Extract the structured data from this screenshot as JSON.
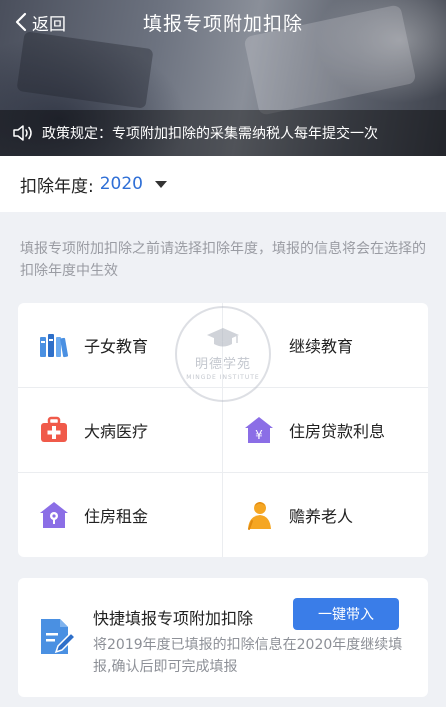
{
  "header": {
    "back_label": "返回",
    "title": "填报专项附加扣除"
  },
  "notice": {
    "text": "政策规定：专项附加扣除的采集需纳税人每年提交一次"
  },
  "year_selector": {
    "label": "扣除年度:",
    "value": "2020"
  },
  "hint": "填报专项附加扣除之前请选择扣除年度，填报的信息将会在选择的扣除年度中生效",
  "categories": [
    {
      "label": "子女教育",
      "icon": "books-icon",
      "color": "#4a90e2"
    },
    {
      "label": "继续教育",
      "icon": "graduation-cap-icon",
      "color": "#a0a8b6"
    },
    {
      "label": "大病医疗",
      "icon": "medical-kit-icon",
      "color": "#f05a4a"
    },
    {
      "label": "住房贷款利息",
      "icon": "house-yen-icon",
      "color": "#8b6ee6"
    },
    {
      "label": "住房租金",
      "icon": "house-key-icon",
      "color": "#8b6ee6"
    },
    {
      "label": "赡养老人",
      "icon": "elder-icon",
      "color": "#f5a623"
    }
  ],
  "watermark": {
    "name": "明德学苑",
    "sub": "MINGDE INSTITUTE"
  },
  "quick_fill": {
    "title": "快捷填报专项附加扣除",
    "button": "一键带入",
    "description": "将2019年度已填报的扣除信息在2020年度继续填报,确认后即可完成填报"
  },
  "colors": {
    "accent": "#2f6fd6",
    "button": "#3a7de8",
    "background": "#eff1f5"
  }
}
